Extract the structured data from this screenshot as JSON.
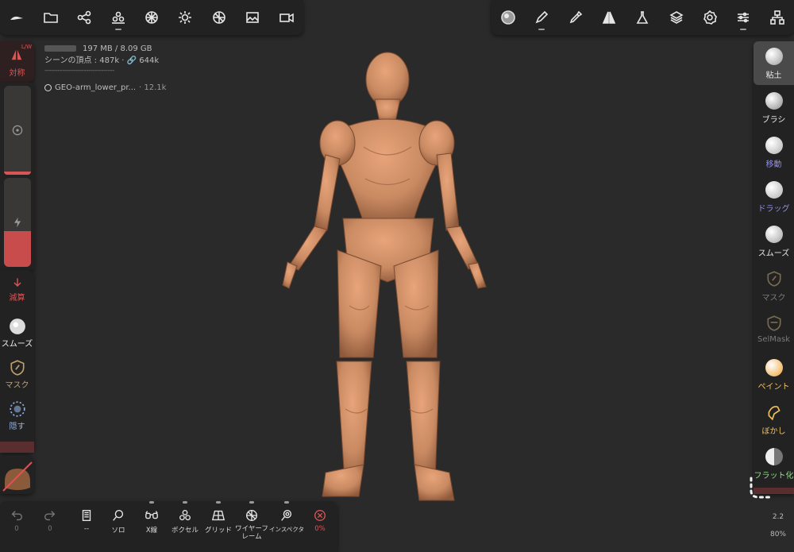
{
  "top_left_toolbar": {
    "icons": [
      "logo-icon",
      "folder-icon",
      "share-icon",
      "primitives-icon",
      "sphere-grid-icon",
      "sun-icon",
      "material-ball-icon",
      "image-icon",
      "camera-icon"
    ]
  },
  "top_right_toolbar": {
    "icons": [
      "brush-preview-icon",
      "pen-icon",
      "eyedropper-icon",
      "symmetry-icon",
      "flask-icon",
      "layers-icon",
      "settings-gear-icon",
      "sliders-icon",
      "scene-tree-icon"
    ]
  },
  "info": {
    "memory": "197 MB / 8.09 GB",
    "scene_vertices": "シーンの頂点 : 487k · 🔗 644k",
    "separator": "--------------------------------",
    "object_name": "GEO-arm_lower_pr...",
    "object_count": "· 12.1k"
  },
  "left": {
    "symmetry_label": "対称",
    "symmetry_badge": "L/W",
    "radius_fill": 0.03,
    "intensity_fill": 0.4,
    "subtract_label": "減算",
    "smooth_label": "スムーズ",
    "mask_label": "マスク",
    "hide_label": "隠す"
  },
  "right_tools": [
    {
      "label": "粘土",
      "color": "#e8e8e8",
      "ball": "#c9c9c9",
      "active": true
    },
    {
      "label": "ブラシ",
      "color": "#e8e8e8",
      "ball": "#bdbdbd",
      "active": false
    },
    {
      "label": "移動",
      "color": "#8f8ee8",
      "ball": "#e3e3e3",
      "active": false
    },
    {
      "label": "ドラッグ",
      "color": "#8f8ee8",
      "ball": "#e3e3e3",
      "active": false
    },
    {
      "label": "スムーズ",
      "color": "#e8e8e8",
      "ball": "#dcdcdc",
      "active": false
    },
    {
      "label": "マスク",
      "color": "#7a7a7a",
      "ball": "",
      "active": false
    },
    {
      "label": "SelMask",
      "color": "#7a7a7a",
      "ball": "",
      "active": false
    },
    {
      "label": "ペイント",
      "color": "#f0c060",
      "ball": "#f0a030",
      "active": false
    },
    {
      "label": "ぼかし",
      "color": "#f0c060",
      "ball": "",
      "active": false
    },
    {
      "label": "フラット化",
      "color": "#8fe080",
      "ball": "#dcdcdc",
      "active": false
    }
  ],
  "bottom_toolbar": [
    {
      "label": "0",
      "icon": "undo-icon"
    },
    {
      "label": "0",
      "icon": "redo-icon"
    },
    {
      "label": "--",
      "icon": "book-icon"
    },
    {
      "label": "ソロ",
      "icon": "solo-search-icon"
    },
    {
      "label": "X線",
      "icon": "xray-glasses-icon"
    },
    {
      "label": "ボクセル",
      "icon": "voxel-icon"
    },
    {
      "label": "グリッド",
      "icon": "grid-icon"
    },
    {
      "label": "ワイヤーフ\nレーム",
      "icon": "wireframe-icon"
    },
    {
      "label": "インスペクタ",
      "icon": "inspector-icon"
    },
    {
      "label": "0%",
      "icon": "close-circle-icon"
    }
  ],
  "bottom_right": {
    "value": "2.2",
    "percent": "80%"
  },
  "colors": {
    "background": "#2b2a2a",
    "panel": "#222222",
    "accent_red": "#d85555",
    "model_skin": "#c98a62"
  }
}
